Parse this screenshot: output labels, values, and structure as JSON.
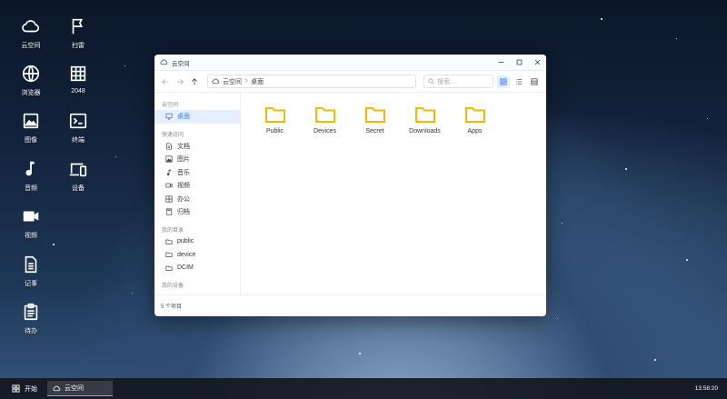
{
  "desktop": {
    "icons": [
      {
        "label": "云空间",
        "icon": "cloud-icon"
      },
      {
        "label": "扫雷",
        "icon": "flag-icon"
      },
      {
        "label": "浏览器",
        "icon": "globe-icon"
      },
      {
        "label": "2048",
        "icon": "grid-icon"
      },
      {
        "label": "图像",
        "icon": "image-icon"
      },
      {
        "label": "终端",
        "icon": "terminal-icon"
      },
      {
        "label": "音频",
        "icon": "music-note-icon"
      },
      {
        "label": "设备",
        "icon": "devices-icon"
      },
      {
        "label": "视频",
        "icon": "video-camera-icon"
      },
      {
        "label": "记事",
        "icon": "document-icon"
      },
      {
        "label": "待办",
        "icon": "clipboard-icon"
      }
    ]
  },
  "window": {
    "title": "云空间",
    "path": {
      "root": "云空间",
      "current": "桌面"
    },
    "search_placeholder": "搜索...",
    "sidebar": {
      "root_label": "云空间",
      "desktop_label": "桌面",
      "quick_access_label": "快速访问",
      "quick_items": [
        {
          "label": "文档",
          "icon": "document-icon"
        },
        {
          "label": "图片",
          "icon": "image-icon"
        },
        {
          "label": "音乐",
          "icon": "music-note-icon"
        },
        {
          "label": "视频",
          "icon": "video-icon"
        },
        {
          "label": "办公",
          "icon": "table-icon"
        },
        {
          "label": "归档",
          "icon": "archive-icon"
        }
      ],
      "my_dirs_label": "我的目录",
      "dir_items": [
        {
          "label": "public"
        },
        {
          "label": "device"
        },
        {
          "label": "DCIM"
        }
      ],
      "my_devices_label": "我的设备"
    },
    "files": [
      {
        "name": "Public"
      },
      {
        "name": "Devices"
      },
      {
        "name": "Secret"
      },
      {
        "name": "Downloads"
      },
      {
        "name": "Apps"
      }
    ],
    "status": "5 个项目"
  },
  "taskbar": {
    "start_label": "开始",
    "task_label": "云空间",
    "clock": "13:58:20"
  },
  "colors": {
    "accent": "#3a78f2",
    "folder": "#f5b800",
    "selected_bg": "#e6efff"
  }
}
